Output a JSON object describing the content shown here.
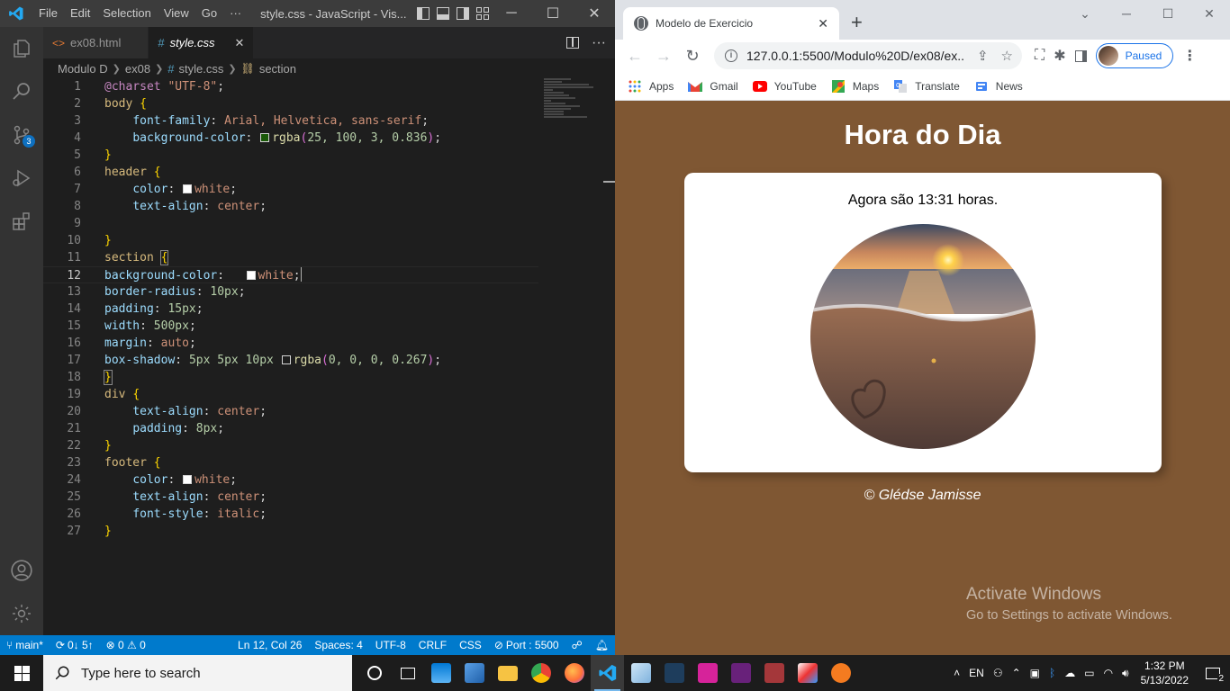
{
  "vscode": {
    "menu": [
      "File",
      "Edit",
      "Selection",
      "View",
      "Go",
      "···"
    ],
    "window_title": "style.css - JavaScript - Vis...",
    "tabs": [
      {
        "label": "ex08.html",
        "icon": "html-file-icon",
        "active": false
      },
      {
        "label": "style.css",
        "icon": "css-file-icon",
        "active": true
      }
    ],
    "breadcrumb": [
      "Modulo D",
      "ex08",
      "style.css",
      "section"
    ],
    "scm_badge": "3",
    "code_lines": [
      {
        "n": "1"
      },
      {
        "n": "2"
      },
      {
        "n": "3"
      },
      {
        "n": "4"
      },
      {
        "n": "5"
      },
      {
        "n": "6"
      },
      {
        "n": "7"
      },
      {
        "n": "8"
      },
      {
        "n": "9"
      },
      {
        "n": "10"
      },
      {
        "n": "11"
      },
      {
        "n": "12"
      },
      {
        "n": "13"
      },
      {
        "n": "14"
      },
      {
        "n": "15"
      },
      {
        "n": "16"
      },
      {
        "n": "17"
      },
      {
        "n": "18"
      },
      {
        "n": "19"
      },
      {
        "n": "20"
      },
      {
        "n": "21"
      },
      {
        "n": "22"
      },
      {
        "n": "23"
      },
      {
        "n": "24"
      },
      {
        "n": "25"
      },
      {
        "n": "26"
      },
      {
        "n": "27"
      }
    ],
    "code": {
      "l1_at": "@charset",
      "l1_val": "\"UTF-8\"",
      "l1_end": ";",
      "l2_sel": "body",
      "l2_br": "{",
      "l3_prop": "font-family",
      "l3_val": "Arial, Helvetica, sans-serif",
      "l4_prop": "background-color",
      "l4_fn": "rgba",
      "l4_args": "25, 100, 3, 0.836",
      "l5_br": "}",
      "l6_sel": "header",
      "l6_br": "{",
      "l7_prop": "color",
      "l7_val": "white",
      "l8_prop": "text-align",
      "l8_val": "center",
      "l10_br": "}",
      "l11_sel": "section",
      "l11_br": "{",
      "l12_prop": "background-color",
      "l12_val": "white",
      "l13_prop": "border-radius",
      "l13_val": "10px",
      "l14_prop": "padding",
      "l14_val": "15px",
      "l15_prop": "width",
      "l15_val": "500px",
      "l16_prop": "margin",
      "l16_val": "auto",
      "l17_prop": "box-shadow",
      "l17_val": "5px 5px 10px",
      "l17_fn": "rgba",
      "l17_args": "0, 0, 0, 0.267",
      "l18_br": "}",
      "l19_sel": "div",
      "l19_br": "{",
      "l20_prop": "text-align",
      "l20_val": "center",
      "l21_prop": "padding",
      "l21_val": "8px",
      "l22_br": "}",
      "l23_sel": "footer",
      "l23_br": "{",
      "l24_prop": "color",
      "l24_val": "white",
      "l25_prop": "text-align",
      "l25_val": "center",
      "l26_prop": "font-style",
      "l26_val": "italic",
      "l27_br": "}"
    },
    "status": {
      "branch": "main*",
      "sync": "0↓ 5↑",
      "problems": "⊗ 0 ⚠ 0",
      "position": "Ln 12, Col 26",
      "spaces": "Spaces: 4",
      "encoding": "UTF-8",
      "eol": "CRLF",
      "language": "CSS",
      "port": "Port : 5500"
    }
  },
  "chrome": {
    "tab_title": "Modelo de Exercicio",
    "url": "127.0.0.1:5500/Modulo%20D/ex08/ex...",
    "profile_label": "Paused",
    "bookmarks": [
      "Apps",
      "Gmail",
      "YouTube",
      "Maps",
      "Translate",
      "News"
    ]
  },
  "page": {
    "title": "Hora do Dia",
    "time_text": "Agora são 13:31 horas.",
    "footer": "© Glédse Jamisse",
    "background_color": "#7f5733",
    "section_color": "#ffffff"
  },
  "watermark": {
    "line1": "Activate Windows",
    "line2": "Go to Settings to activate Windows."
  },
  "taskbar": {
    "search_placeholder": "Type here to search",
    "language": "EN",
    "time": "1:32 PM",
    "date": "5/13/2022",
    "notifications": "2"
  }
}
